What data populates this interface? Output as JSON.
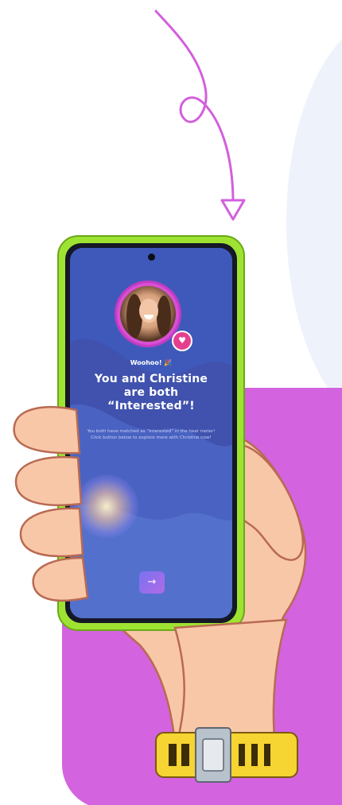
{
  "screen": {
    "greeting": "Woohoo! 🎉",
    "headline_line1": "You and Christine",
    "headline_line2": "are both",
    "headline_line3": "“Interested”!",
    "subtext": "You both have matched as “Interested” in the heat meter! Click button below to explore more with Christine now!",
    "next_button_icon": "→",
    "badge_icon": "♥",
    "match_name": "Christine"
  },
  "colors": {
    "panel": "#d363df",
    "phone_frame": "#9ee332",
    "screen_bg": "#4052ae",
    "arrow_doodle": "#d35fdc",
    "skin": "#f8c7a8",
    "watch_band": "#f6d431"
  },
  "icons": [
    "arrow-doodle-icon",
    "heart-icon",
    "arrow-right-icon"
  ]
}
